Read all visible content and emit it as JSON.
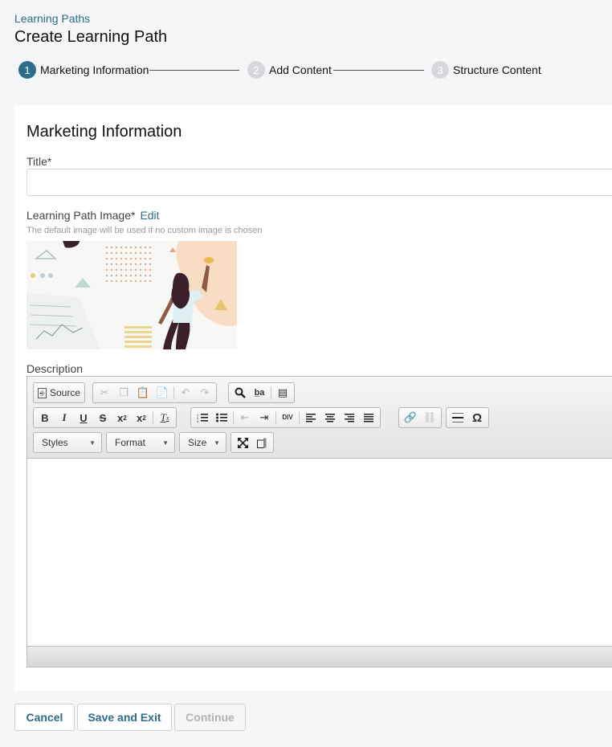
{
  "header": {
    "breadcrumb": "Learning Paths",
    "title": "Create Learning Path"
  },
  "stepper": {
    "steps": [
      {
        "number": "1",
        "label": "Marketing Information",
        "active": true
      },
      {
        "number": "2",
        "label": "Add Content",
        "active": false
      },
      {
        "number": "3",
        "label": "Structure Content",
        "active": false
      }
    ]
  },
  "form": {
    "section_title": "Marketing Information",
    "title_label": "Title*",
    "title_value": "",
    "image_label": "Learning Path Image*",
    "image_edit": "Edit",
    "image_hint": "The default image will be used if no custom image is chosen",
    "description_label": "Description"
  },
  "editor": {
    "toolbar": {
      "source_label": "Source",
      "styles_label": "Styles",
      "format_label": "Format",
      "size_label": "Size"
    },
    "content": ""
  },
  "footer": {
    "cancel_label": "Cancel",
    "save_exit_label": "Save and Exit",
    "continue_label": "Continue"
  },
  "colors": {
    "accent": "#2b6d8a",
    "step_inactive": "#d6d8db",
    "background": "#f5f6f7"
  }
}
